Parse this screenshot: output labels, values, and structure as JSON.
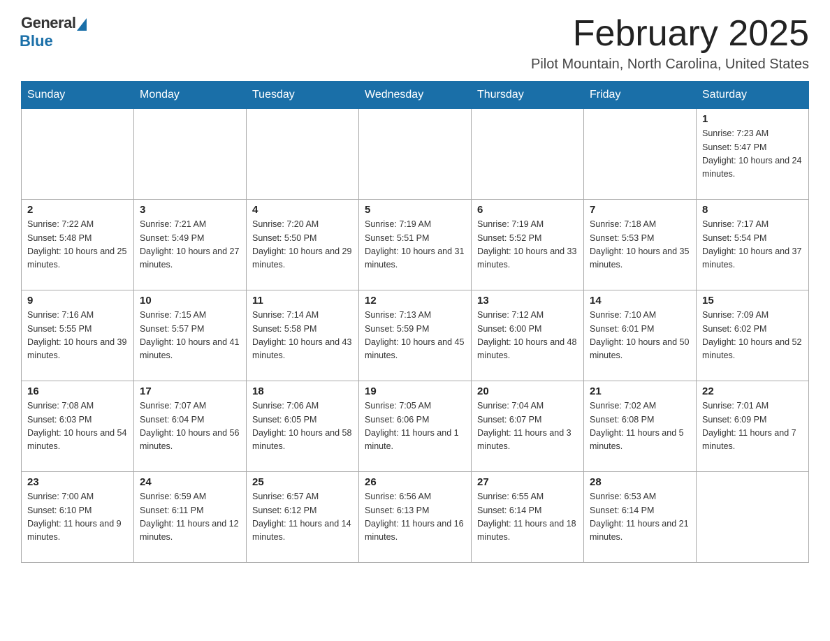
{
  "logo": {
    "general": "General",
    "blue": "Blue"
  },
  "title": "February 2025",
  "subtitle": "Pilot Mountain, North Carolina, United States",
  "weekdays": [
    "Sunday",
    "Monday",
    "Tuesday",
    "Wednesday",
    "Thursday",
    "Friday",
    "Saturday"
  ],
  "weeks": [
    [
      {
        "day": "",
        "sunrise": "",
        "sunset": "",
        "daylight": ""
      },
      {
        "day": "",
        "sunrise": "",
        "sunset": "",
        "daylight": ""
      },
      {
        "day": "",
        "sunrise": "",
        "sunset": "",
        "daylight": ""
      },
      {
        "day": "",
        "sunrise": "",
        "sunset": "",
        "daylight": ""
      },
      {
        "day": "",
        "sunrise": "",
        "sunset": "",
        "daylight": ""
      },
      {
        "day": "",
        "sunrise": "",
        "sunset": "",
        "daylight": ""
      },
      {
        "day": "1",
        "sunrise": "Sunrise: 7:23 AM",
        "sunset": "Sunset: 5:47 PM",
        "daylight": "Daylight: 10 hours and 24 minutes."
      }
    ],
    [
      {
        "day": "2",
        "sunrise": "Sunrise: 7:22 AM",
        "sunset": "Sunset: 5:48 PM",
        "daylight": "Daylight: 10 hours and 25 minutes."
      },
      {
        "day": "3",
        "sunrise": "Sunrise: 7:21 AM",
        "sunset": "Sunset: 5:49 PM",
        "daylight": "Daylight: 10 hours and 27 minutes."
      },
      {
        "day": "4",
        "sunrise": "Sunrise: 7:20 AM",
        "sunset": "Sunset: 5:50 PM",
        "daylight": "Daylight: 10 hours and 29 minutes."
      },
      {
        "day": "5",
        "sunrise": "Sunrise: 7:19 AM",
        "sunset": "Sunset: 5:51 PM",
        "daylight": "Daylight: 10 hours and 31 minutes."
      },
      {
        "day": "6",
        "sunrise": "Sunrise: 7:19 AM",
        "sunset": "Sunset: 5:52 PM",
        "daylight": "Daylight: 10 hours and 33 minutes."
      },
      {
        "day": "7",
        "sunrise": "Sunrise: 7:18 AM",
        "sunset": "Sunset: 5:53 PM",
        "daylight": "Daylight: 10 hours and 35 minutes."
      },
      {
        "day": "8",
        "sunrise": "Sunrise: 7:17 AM",
        "sunset": "Sunset: 5:54 PM",
        "daylight": "Daylight: 10 hours and 37 minutes."
      }
    ],
    [
      {
        "day": "9",
        "sunrise": "Sunrise: 7:16 AM",
        "sunset": "Sunset: 5:55 PM",
        "daylight": "Daylight: 10 hours and 39 minutes."
      },
      {
        "day": "10",
        "sunrise": "Sunrise: 7:15 AM",
        "sunset": "Sunset: 5:57 PM",
        "daylight": "Daylight: 10 hours and 41 minutes."
      },
      {
        "day": "11",
        "sunrise": "Sunrise: 7:14 AM",
        "sunset": "Sunset: 5:58 PM",
        "daylight": "Daylight: 10 hours and 43 minutes."
      },
      {
        "day": "12",
        "sunrise": "Sunrise: 7:13 AM",
        "sunset": "Sunset: 5:59 PM",
        "daylight": "Daylight: 10 hours and 45 minutes."
      },
      {
        "day": "13",
        "sunrise": "Sunrise: 7:12 AM",
        "sunset": "Sunset: 6:00 PM",
        "daylight": "Daylight: 10 hours and 48 minutes."
      },
      {
        "day": "14",
        "sunrise": "Sunrise: 7:10 AM",
        "sunset": "Sunset: 6:01 PM",
        "daylight": "Daylight: 10 hours and 50 minutes."
      },
      {
        "day": "15",
        "sunrise": "Sunrise: 7:09 AM",
        "sunset": "Sunset: 6:02 PM",
        "daylight": "Daylight: 10 hours and 52 minutes."
      }
    ],
    [
      {
        "day": "16",
        "sunrise": "Sunrise: 7:08 AM",
        "sunset": "Sunset: 6:03 PM",
        "daylight": "Daylight: 10 hours and 54 minutes."
      },
      {
        "day": "17",
        "sunrise": "Sunrise: 7:07 AM",
        "sunset": "Sunset: 6:04 PM",
        "daylight": "Daylight: 10 hours and 56 minutes."
      },
      {
        "day": "18",
        "sunrise": "Sunrise: 7:06 AM",
        "sunset": "Sunset: 6:05 PM",
        "daylight": "Daylight: 10 hours and 58 minutes."
      },
      {
        "day": "19",
        "sunrise": "Sunrise: 7:05 AM",
        "sunset": "Sunset: 6:06 PM",
        "daylight": "Daylight: 11 hours and 1 minute."
      },
      {
        "day": "20",
        "sunrise": "Sunrise: 7:04 AM",
        "sunset": "Sunset: 6:07 PM",
        "daylight": "Daylight: 11 hours and 3 minutes."
      },
      {
        "day": "21",
        "sunrise": "Sunrise: 7:02 AM",
        "sunset": "Sunset: 6:08 PM",
        "daylight": "Daylight: 11 hours and 5 minutes."
      },
      {
        "day": "22",
        "sunrise": "Sunrise: 7:01 AM",
        "sunset": "Sunset: 6:09 PM",
        "daylight": "Daylight: 11 hours and 7 minutes."
      }
    ],
    [
      {
        "day": "23",
        "sunrise": "Sunrise: 7:00 AM",
        "sunset": "Sunset: 6:10 PM",
        "daylight": "Daylight: 11 hours and 9 minutes."
      },
      {
        "day": "24",
        "sunrise": "Sunrise: 6:59 AM",
        "sunset": "Sunset: 6:11 PM",
        "daylight": "Daylight: 11 hours and 12 minutes."
      },
      {
        "day": "25",
        "sunrise": "Sunrise: 6:57 AM",
        "sunset": "Sunset: 6:12 PM",
        "daylight": "Daylight: 11 hours and 14 minutes."
      },
      {
        "day": "26",
        "sunrise": "Sunrise: 6:56 AM",
        "sunset": "Sunset: 6:13 PM",
        "daylight": "Daylight: 11 hours and 16 minutes."
      },
      {
        "day": "27",
        "sunrise": "Sunrise: 6:55 AM",
        "sunset": "Sunset: 6:14 PM",
        "daylight": "Daylight: 11 hours and 18 minutes."
      },
      {
        "day": "28",
        "sunrise": "Sunrise: 6:53 AM",
        "sunset": "Sunset: 6:14 PM",
        "daylight": "Daylight: 11 hours and 21 minutes."
      },
      {
        "day": "",
        "sunrise": "",
        "sunset": "",
        "daylight": ""
      }
    ]
  ]
}
